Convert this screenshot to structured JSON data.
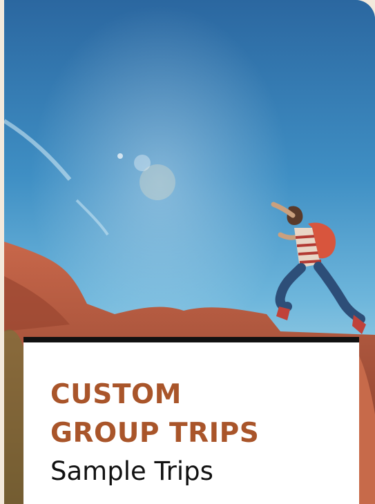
{
  "card": {
    "image_alt": "Hiker leaping between red rocks under a blue sky",
    "title_lines": [
      "CUSTOM",
      "GROUP TRIPS"
    ],
    "subtitle": "Sample Trips"
  },
  "colors": {
    "page_background": "#f3e9dc",
    "title": "#a9552a",
    "subtitle": "#111111",
    "panel": "#ffffff",
    "panel_border": "#111111",
    "sky_top": "#2f6fa8",
    "sky_bottom": "#78bfe0",
    "rocks": "#b8593c"
  }
}
